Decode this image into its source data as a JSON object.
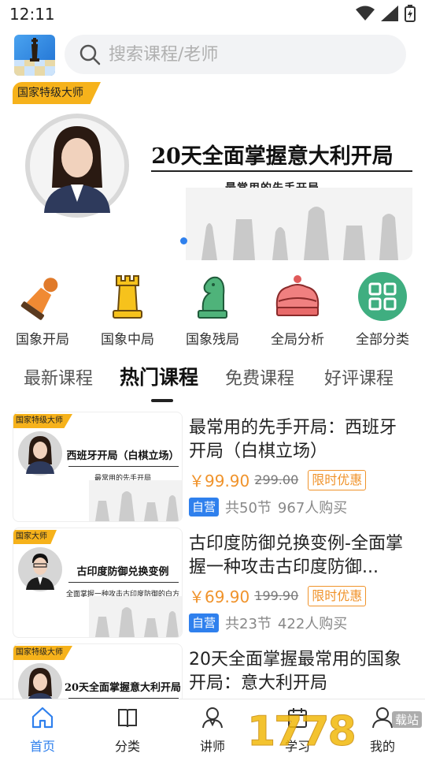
{
  "status_bar": {
    "time": "12:11"
  },
  "search": {
    "placeholder": "搜索课程/老师"
  },
  "banner": {
    "tag": "国家特级大师",
    "title": "20天全面掌握意大利开局",
    "subtitle": "最常用的先手开局"
  },
  "categories": [
    {
      "label": "国象开局",
      "icon": "pawn-icon"
    },
    {
      "label": "国象中局",
      "icon": "rook-icon"
    },
    {
      "label": "国象残局",
      "icon": "knight-icon"
    },
    {
      "label": "全局分析",
      "icon": "crown-icon"
    },
    {
      "label": "全部分类",
      "icon": "grid-icon"
    }
  ],
  "tabs": [
    {
      "label": "最新课程"
    },
    {
      "label": "热门课程"
    },
    {
      "label": "免费课程"
    },
    {
      "label": "好评课程"
    }
  ],
  "active_tab": "热门课程",
  "courses": [
    {
      "thumb_tag": "国家特级大师",
      "thumb_title": "西班牙开局（白棋立场）",
      "thumb_sub": "最常用的先手开局",
      "title": "最常用的先手开局：西班牙开局（白棋立场）",
      "price": "￥99.90",
      "old_price": "299.00",
      "promo": "限时优惠",
      "badge": "自营",
      "lessons": "共50节",
      "buyers": "967人购买"
    },
    {
      "thumb_tag": "国家大师",
      "thumb_title": "古印度防御兑换变例",
      "thumb_sub": "全面掌握一种攻击古印度防御的白方开局",
      "title": "古印度防御兑换变例-全面掌握一种攻击古印度防御...",
      "price": "￥69.90",
      "old_price": "199.90",
      "promo": "限时优惠",
      "badge": "自营",
      "lessons": "共23节",
      "buyers": "422人购买"
    },
    {
      "thumb_tag": "国家特级大师",
      "thumb_title": "20天全面掌握意大利开局",
      "thumb_sub": "",
      "title": "20天全面掌握最常用的国象开局：意大利开局",
      "price": "",
      "old_price": "",
      "promo": "",
      "badge": "",
      "lessons": "",
      "buyers": ""
    }
  ],
  "bottom_nav": [
    {
      "label": "首页",
      "icon": "home-icon",
      "active": true
    },
    {
      "label": "分类",
      "icon": "book-icon",
      "active": false
    },
    {
      "label": "讲师",
      "icon": "teacher-icon",
      "active": false
    },
    {
      "label": "学习",
      "icon": "calendar-icon",
      "active": false
    },
    {
      "label": "我的",
      "icon": "user-icon",
      "active": false
    }
  ],
  "watermark": {
    "number": "1778",
    "badge": "载站"
  },
  "colors": {
    "accent": "#2f80ed",
    "price": "#f0932b",
    "tag": "#f6b21b"
  }
}
